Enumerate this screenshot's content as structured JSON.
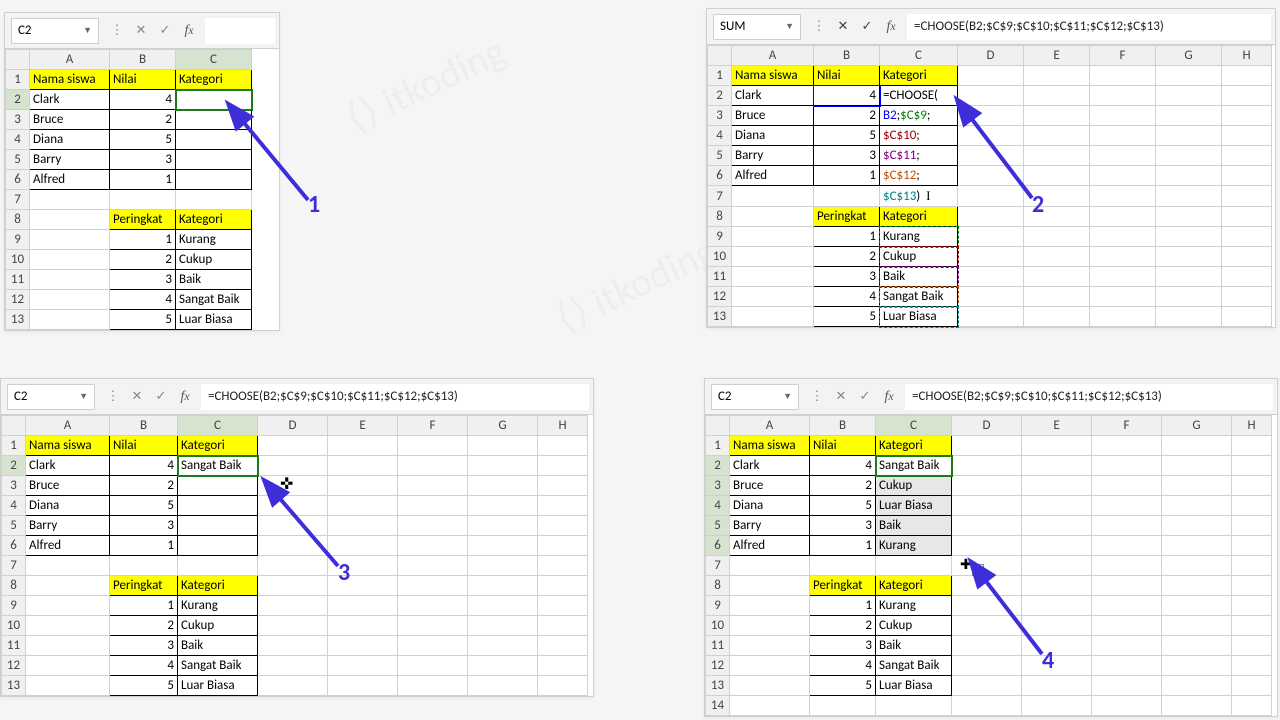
{
  "formula": "=CHOOSE(B2;$C$9;$C$10;$C$11;$C$12;$C$13)",
  "columns": [
    "A",
    "B",
    "C",
    "D",
    "E",
    "F",
    "G",
    "H"
  ],
  "rows": [
    "1",
    "2",
    "3",
    "4",
    "5",
    "6",
    "7",
    "8",
    "9",
    "10",
    "11",
    "12",
    "13"
  ],
  "headers": {
    "name": "Nama siswa",
    "score": "Nilai",
    "cat": "Kategori",
    "rank": "Peringkat"
  },
  "students": [
    {
      "name": "Clark",
      "score": 4,
      "cat": "Sangat Baik"
    },
    {
      "name": "Bruce",
      "score": 2,
      "cat": "Cukup"
    },
    {
      "name": "Diana",
      "score": 5,
      "cat": "Luar Biasa"
    },
    {
      "name": "Barry",
      "score": 3,
      "cat": "Baik"
    },
    {
      "name": "Alfred",
      "score": 1,
      "cat": "Kurang"
    }
  ],
  "lookup": [
    {
      "rank": 1,
      "cat": "Kurang"
    },
    {
      "rank": 2,
      "cat": "Cukup"
    },
    {
      "rank": 3,
      "cat": "Baik"
    },
    {
      "rank": 4,
      "cat": "Sangat Baik"
    },
    {
      "rank": 5,
      "cat": "Luar Biasa"
    }
  ],
  "panels": {
    "p1": {
      "namebox": "C2",
      "formula": "",
      "step": "1"
    },
    "p2": {
      "namebox": "SUM",
      "formula_prefix": "=CHOOSE(",
      "step": "2",
      "cell_parts": [
        "=CHOOSE(",
        "B2",
        ";",
        "$C$9",
        ";",
        "$C$10",
        ";",
        "$C$11",
        ";",
        "$C$12",
        ";",
        "$C$13",
        ")"
      ]
    },
    "p3": {
      "namebox": "C2",
      "step": "3"
    },
    "p4": {
      "namebox": "C2",
      "step": "4"
    }
  }
}
